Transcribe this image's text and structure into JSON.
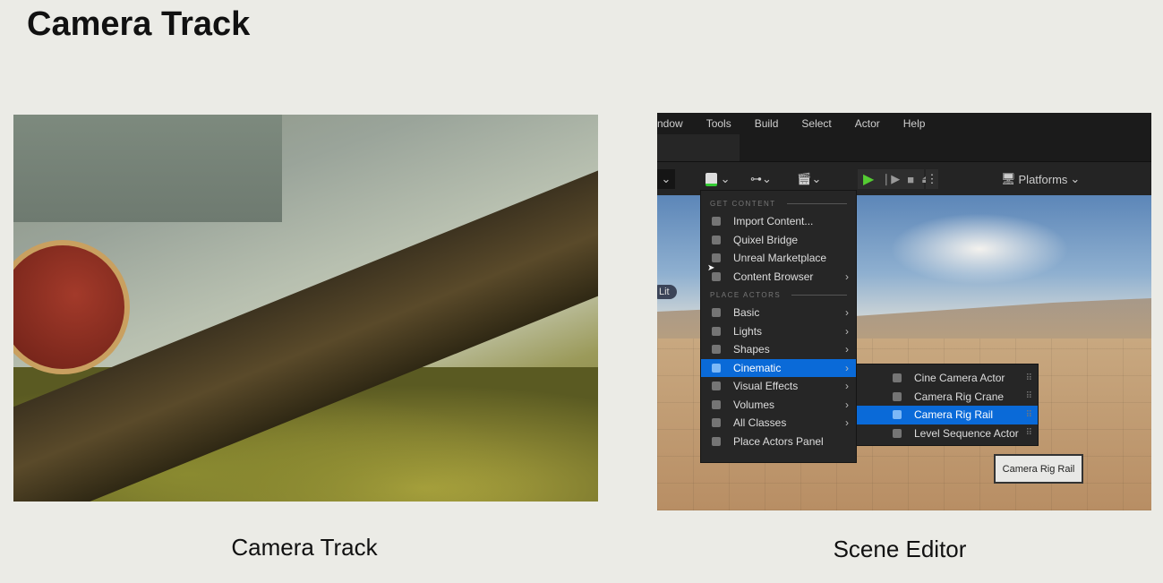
{
  "title": "Camera Track",
  "captions": {
    "left": "Camera Track",
    "right": "Scene Editor"
  },
  "editor": {
    "menubar": [
      "ndow",
      "Tools",
      "Build",
      "Select",
      "Actor",
      "Help"
    ],
    "toolbar": {
      "platforms": "Platforms",
      "viewmode": "Lit"
    },
    "menu": {
      "sections": [
        {
          "header": "GET CONTENT",
          "items": [
            {
              "label": "Import Content...",
              "icon": "import-icon"
            },
            {
              "label": "Quixel Bridge",
              "icon": "bridge-icon"
            },
            {
              "label": "Unreal Marketplace",
              "icon": "marketplace-icon"
            },
            {
              "label": "Content Browser",
              "icon": "content-browser-icon",
              "submenu": true
            }
          ]
        },
        {
          "header": "PLACE ACTORS",
          "items": [
            {
              "label": "Basic",
              "icon": "basic-icon",
              "submenu": true
            },
            {
              "label": "Lights",
              "icon": "light-icon",
              "submenu": true
            },
            {
              "label": "Shapes",
              "icon": "shapes-icon",
              "submenu": true
            },
            {
              "label": "Cinematic",
              "icon": "cinematic-icon",
              "submenu": true,
              "selected": true
            },
            {
              "label": "Visual Effects",
              "icon": "vfx-icon",
              "submenu": true
            },
            {
              "label": "Volumes",
              "icon": "volume-icon",
              "submenu": true
            },
            {
              "label": "All Classes",
              "icon": "classes-icon",
              "submenu": true
            },
            {
              "label": "Place Actors Panel",
              "icon": "place-actors-icon"
            }
          ]
        }
      ]
    },
    "submenu": [
      {
        "label": "Cine Camera Actor"
      },
      {
        "label": "Camera Rig Crane"
      },
      {
        "label": "Camera Rig Rail",
        "selected": true
      },
      {
        "label": "Level Sequence Actor"
      }
    ],
    "tooltip": "Camera Rig Rail",
    "accent": "#0a6ad8"
  }
}
